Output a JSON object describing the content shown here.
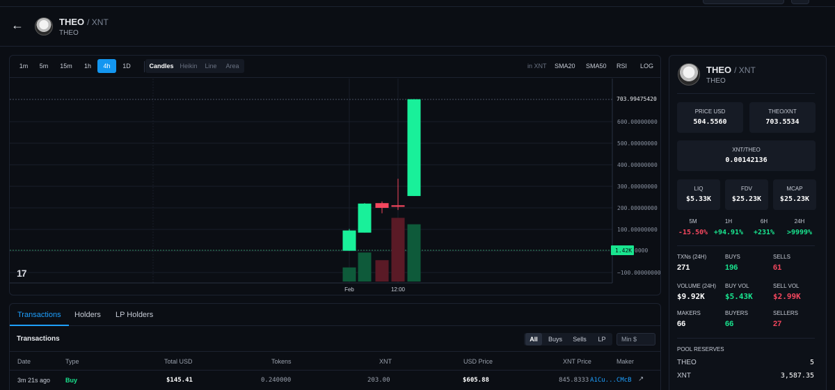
{
  "token": {
    "symbol": "THEO",
    "quote": "/ XNT",
    "name": "THEO"
  },
  "chart_toolbar": {
    "timeframes": [
      "1m",
      "5m",
      "15m",
      "1h",
      "4h",
      "1D"
    ],
    "active_timeframe": "4h",
    "styles": [
      "Candles",
      "Heikin",
      "Line",
      "Area"
    ],
    "active_style": "Candles",
    "in_unit": "in XNT",
    "indicators": [
      "SMA20",
      "SMA50",
      "RSI"
    ],
    "log": "LOG"
  },
  "chart_data": {
    "type": "candlestick",
    "x_ticks": [
      "Feb",
      "12:00"
    ],
    "y_ticks": [
      "600.00000000",
      "500.00000000",
      "400.00000000",
      "300.00000000",
      "200.00000000",
      "100.00000000",
      "−100.00000000"
    ],
    "ylim": [
      -150,
      760
    ],
    "last_price_label": "703.99475420",
    "volume_label": "1.42K",
    "volume_label_tail": "0000",
    "candles": [
      {
        "open": 1,
        "high": 102,
        "low": 1,
        "close": 95,
        "volume": 0.35
      },
      {
        "open": 85,
        "high": 222,
        "low": 85,
        "close": 220,
        "volume": 0.72
      },
      {
        "open": 222,
        "high": 230,
        "low": 175,
        "close": 200,
        "volume": 0.53
      },
      {
        "open": 212,
        "high": 335,
        "low": 190,
        "close": 205,
        "volume": 1.58
      },
      {
        "open": 255,
        "high": 705,
        "low": 255,
        "close": 704,
        "volume": 1.42
      }
    ],
    "colors": {
      "up": "#19f09a",
      "down": "#f5475e",
      "vol_up": "#0e5a3a",
      "vol_down": "#5a1a26"
    }
  },
  "tabs": [
    "Transactions",
    "Holders",
    "LP Holders"
  ],
  "active_tab": "Transactions",
  "transactions": {
    "title": "Transactions",
    "filters": [
      "All",
      "Buys",
      "Sells",
      "LP"
    ],
    "active_filter": "All",
    "min_placeholder": "Min $",
    "columns": [
      "Date",
      "Type",
      "Total USD",
      "Tokens",
      "XNT",
      "USD Price",
      "XNT Price",
      "Maker"
    ],
    "rows": [
      {
        "date": "3m 21s ago",
        "type": "Buy",
        "total_usd": "$145.41",
        "tokens": "0.240000",
        "xnt": "203.00",
        "usd_price": "$605.88",
        "xnt_price": "845.8333",
        "maker": "A1Cu...CMcB"
      }
    ]
  },
  "side": {
    "price_usd_label": "PRICE USD",
    "price_usd": "504.5560",
    "pair_label": "THEO/XNT",
    "pair_value": "703.5534",
    "inverse_label": "XNT/THEO",
    "inverse_value": "0.00142136",
    "liq_label": "LIQ",
    "liq": "$5.33K",
    "fdv_label": "FDV",
    "fdv": "$25.23K",
    "mcap_label": "MCAP",
    "mcap": "$25.23K",
    "changes": [
      {
        "label": "5M",
        "value": "-15.50%",
        "dir": "down"
      },
      {
        "label": "1H",
        "value": "+94.91%",
        "dir": "up"
      },
      {
        "label": "6H",
        "value": "+231%",
        "dir": "up"
      },
      {
        "label": "24H",
        "value": ">9999%",
        "dir": "up"
      }
    ],
    "txns_label": "TXNs (24H)",
    "txns": "271",
    "buys_label": "BUYS",
    "buys": "196",
    "sells_label": "SELLS",
    "sells": "61",
    "volume_label": "VOLUME (24H)",
    "volume": "$9.92K",
    "buy_vol_label": "BUY VOL",
    "buy_vol": "$5.43K",
    "sell_vol_label": "SELL VOL",
    "sell_vol": "$2.99K",
    "makers_label": "MAKERS",
    "makers": "66",
    "buyers_label": "BUYERS",
    "buyers": "66",
    "sellers_label": "SELLERS",
    "sellers": "27",
    "pool_title": "POOL RESERVES",
    "pool": [
      {
        "label": "THEO",
        "value": "5"
      },
      {
        "label": "XNT",
        "value": "3,587.35"
      }
    ]
  },
  "icons": {
    "back": "arrow-left-icon",
    "external": "external-link-icon",
    "tv_logo": "tradingview-logo"
  }
}
